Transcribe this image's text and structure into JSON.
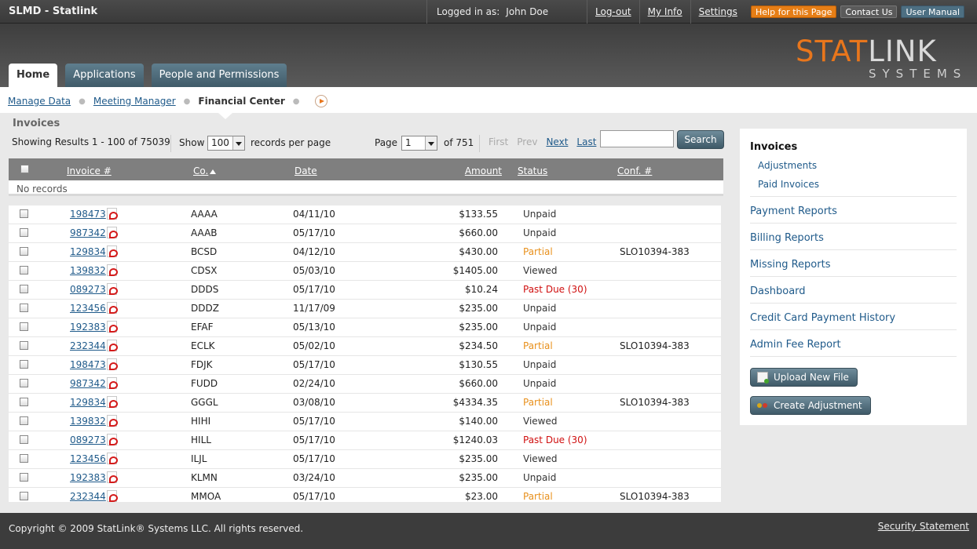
{
  "topbar": {
    "app_title": "SLMD - Statlink",
    "logged_label": "Logged in as:",
    "user_name": "John Doe",
    "links": [
      "Log-out",
      "My Info",
      "Settings"
    ],
    "buttons": {
      "help": "Help for this Page",
      "contact": "Contact Us",
      "manual": "User Manual"
    }
  },
  "logo": {
    "stat": "STAT",
    "link": "LINK",
    "systems": "SYSTEMS"
  },
  "tabs": [
    {
      "label": "Home",
      "active": true
    },
    {
      "label": "Applications",
      "active": false
    },
    {
      "label": "People and Permissions",
      "active": false
    }
  ],
  "breadcrumb": {
    "items": [
      "Manage Data",
      "Meeting Manager"
    ],
    "current": "Financial Center"
  },
  "invoices": {
    "title": "Invoices",
    "showing": "Showing Results 1 - 100 of 75039",
    "show_label": "Show",
    "per_page_value": "100",
    "per_page_suffix": "records per page",
    "page_label": "Page",
    "page_value": "1",
    "of_pages": "of 751",
    "nav": {
      "first": "First",
      "prev": "Prev",
      "next": "Next",
      "last": "Last"
    },
    "search_placeholder": "",
    "search_button": "Search",
    "columns": {
      "invoice": "Invoice #",
      "co": "Co.",
      "date": "Date",
      "amount": "Amount",
      "status": "Status",
      "conf": "Conf. #"
    },
    "no_records": "No records",
    "rows": [
      {
        "inv": "198473",
        "co": "AAAA",
        "date": "04/11/10",
        "amount": "$133.55",
        "status": "Unpaid",
        "status_type": "unpaid",
        "conf": ""
      },
      {
        "inv": "987342",
        "co": "AAAB",
        "date": "05/17/10",
        "amount": "$660.00",
        "status": "Unpaid",
        "status_type": "unpaid",
        "conf": ""
      },
      {
        "inv": "129834",
        "co": "BCSD",
        "date": "04/12/10",
        "amount": "$430.00",
        "status": "Partial",
        "status_type": "partial",
        "conf": "SLO10394-383"
      },
      {
        "inv": "139832",
        "co": "CDSX",
        "date": "05/03/10",
        "amount": "$1405.00",
        "status": "Viewed",
        "status_type": "viewed",
        "conf": ""
      },
      {
        "inv": "089273",
        "co": "DDDS",
        "date": "05/17/10",
        "amount": "$10.24",
        "status": "Past Due (30)",
        "status_type": "pastdue",
        "conf": ""
      },
      {
        "inv": "123456",
        "co": "DDDZ",
        "date": "11/17/09",
        "amount": "$235.00",
        "status": "Unpaid",
        "status_type": "unpaid",
        "conf": ""
      },
      {
        "inv": "192383",
        "co": "EFAF",
        "date": "05/13/10",
        "amount": "$235.00",
        "status": "Unpaid",
        "status_type": "unpaid",
        "conf": ""
      },
      {
        "inv": "232344",
        "co": "ECLK",
        "date": "05/02/10",
        "amount": "$234.50",
        "status": "Partial",
        "status_type": "partial",
        "conf": "SLO10394-383"
      },
      {
        "inv": "198473",
        "co": "FDJK",
        "date": "05/17/10",
        "amount": "$130.55",
        "status": "Unpaid",
        "status_type": "unpaid",
        "conf": ""
      },
      {
        "inv": "987342",
        "co": "FUDD",
        "date": "02/24/10",
        "amount": "$660.00",
        "status": "Unpaid",
        "status_type": "unpaid",
        "conf": ""
      },
      {
        "inv": "129834",
        "co": "GGGL",
        "date": "03/08/10",
        "amount": "$4334.35",
        "status": "Partial",
        "status_type": "partial",
        "conf": "SLO10394-383"
      },
      {
        "inv": "139832",
        "co": "HIHI",
        "date": "05/17/10",
        "amount": "$140.00",
        "status": "Viewed",
        "status_type": "viewed",
        "conf": ""
      },
      {
        "inv": "089273",
        "co": "HILL",
        "date": "05/17/10",
        "amount": "$1240.03",
        "status": "Past Due (30)",
        "status_type": "pastdue",
        "conf": ""
      },
      {
        "inv": "123456",
        "co": "ILJL",
        "date": "05/17/10",
        "amount": "$235.00",
        "status": "Viewed",
        "status_type": "viewed",
        "conf": ""
      },
      {
        "inv": "192383",
        "co": "KLMN",
        "date": "03/24/10",
        "amount": "$235.00",
        "status": "Unpaid",
        "status_type": "unpaid",
        "conf": ""
      },
      {
        "inv": "232344",
        "co": "MMOA",
        "date": "05/17/10",
        "amount": "$23.00",
        "status": "Partial",
        "status_type": "partial",
        "conf": "SLO10394-383"
      }
    ]
  },
  "sidebar": {
    "section_title": "Invoices",
    "sub_items": [
      "Adjustments",
      "Paid Invoices"
    ],
    "items": [
      "Payment Reports",
      "Billing Reports",
      "Missing Reports",
      "Dashboard",
      "Credit Card Payment History",
      "Admin Fee Report"
    ],
    "buttons": {
      "upload": "Upload New File",
      "adjust": "Create Adjustment"
    }
  },
  "footer": {
    "copyright": "Copyright © 2009 StatLink® Systems LLC. All rights reserved.",
    "security": "Security Statement"
  },
  "colors": {
    "accent": "#e8761c",
    "tab": "#4d6f82",
    "partial": "#e8901c",
    "pastdue": "#d01010"
  }
}
